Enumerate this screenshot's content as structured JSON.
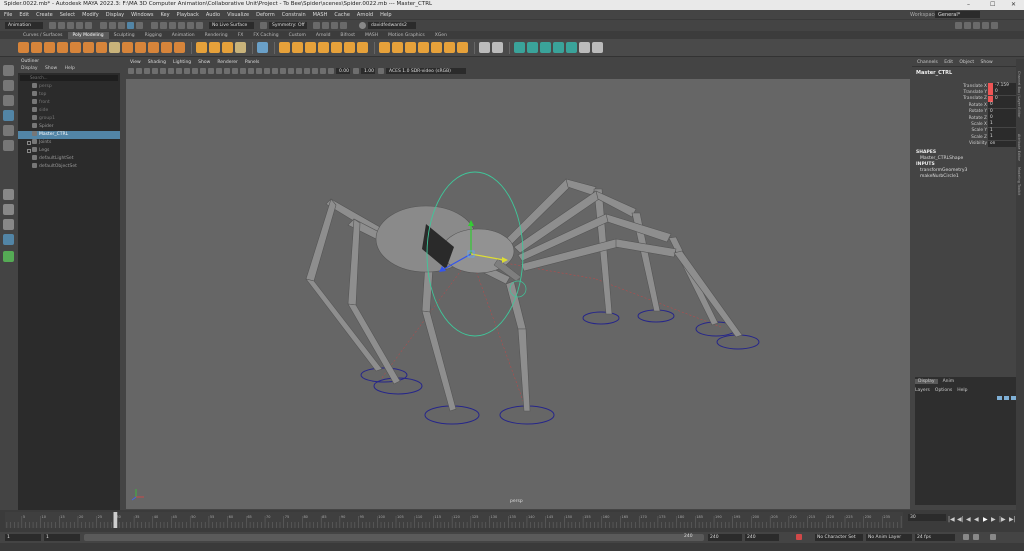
{
  "window": {
    "title": "Spider.0022.mb* - Autodesk MAYA 2022.3: F:\\MA 3D Computer Animation\\Collaborative Unit\\Project - To Bee\\Spider\\scenes\\Spider.0022.mb --- Master_CTRL",
    "controls": [
      "–",
      "☐",
      "✕"
    ]
  },
  "menubar": [
    "File",
    "Edit",
    "Create",
    "Select",
    "Modify",
    "Display",
    "Windows",
    "Key",
    "Playback",
    "Audio",
    "Visualize",
    "Deform",
    "Constrain",
    "MASH",
    "Cache",
    "Arnold",
    "Help"
  ],
  "workspace": {
    "label": "Workspace:",
    "value": "General*"
  },
  "statusline": {
    "mode": "Animation",
    "live_surface": "No Live Surface",
    "symmetry": "Symmetry: Off",
    "user": "davidfedwards2"
  },
  "shelf_tabs": [
    "Curves / Surfaces",
    "Poly Modeling",
    "Sculpting",
    "Rigging",
    "Animation",
    "Rendering",
    "FX",
    "FX Caching",
    "Custom",
    "Arnold",
    "Bifrost",
    "MASH",
    "Motion Graphics",
    "XGen"
  ],
  "shelf_active": "Poly Modeling",
  "outliner": {
    "title": "Outliner",
    "menu": [
      "Display",
      "Show",
      "Help"
    ],
    "search_placeholder": "Search...",
    "items": [
      {
        "label": "persp",
        "state": "dim"
      },
      {
        "label": "top",
        "state": "dim"
      },
      {
        "label": "front",
        "state": "dim"
      },
      {
        "label": "side",
        "state": "dim"
      },
      {
        "label": "group1",
        "state": "dim"
      },
      {
        "label": "Spider",
        "state": "normal"
      },
      {
        "label": "Master_CTRL",
        "state": "selected"
      },
      {
        "label": "Joints",
        "state": "normal"
      },
      {
        "label": "Legs",
        "state": "normal"
      },
      {
        "label": "defaultLightSet",
        "state": "normal"
      },
      {
        "label": "defaultObjectSet",
        "state": "normal"
      }
    ]
  },
  "viewport": {
    "menu": [
      "View",
      "Shading",
      "Lighting",
      "Show",
      "Renderer",
      "Panels"
    ],
    "exposure": "0.00",
    "gamma": "1.00",
    "color_space": "ACES 1.0 SDR-video (sRGB)",
    "camera_label": "persp"
  },
  "channel_box": {
    "tabs": [
      "Channels",
      "Edit",
      "Object",
      "Show"
    ],
    "object": "Master_CTRL",
    "channels": [
      {
        "name": "Translate X",
        "value": "-7.159"
      },
      {
        "name": "Translate Y",
        "value": "0"
      },
      {
        "name": "Translate Z",
        "value": "0"
      },
      {
        "name": "Rotate X",
        "value": "0"
      },
      {
        "name": "Rotate Y",
        "value": "0"
      },
      {
        "name": "Rotate Z",
        "value": "0"
      },
      {
        "name": "Scale X",
        "value": "1"
      },
      {
        "name": "Scale Y",
        "value": "1"
      },
      {
        "name": "Scale Z",
        "value": "1"
      },
      {
        "name": "Visibility",
        "value": "on"
      }
    ],
    "shapes_header": "SHAPES",
    "shape": "Master_CTRLShape",
    "inputs_header": "INPUTS",
    "inputs": [
      "transformGeometry3",
      "makeNurbCircle1"
    ]
  },
  "layer_editor": {
    "tabs": [
      "Display",
      "Anim"
    ],
    "menu": [
      "Layers",
      "Options",
      "Help"
    ]
  },
  "right_strip": [
    "Channel Box / Layer Editor",
    "Attribute Editor",
    "Modeling Toolkit"
  ],
  "timeline": {
    "ticks": [
      "5",
      "10",
      "15",
      "20",
      "25",
      "30",
      "35",
      "40",
      "45",
      "50",
      "55",
      "60",
      "65",
      "70",
      "75",
      "80",
      "85",
      "90",
      "95",
      "100",
      "105",
      "110",
      "115",
      "120",
      "125",
      "130",
      "135",
      "140",
      "145",
      "150",
      "155",
      "160",
      "165",
      "170",
      "175",
      "180",
      "185",
      "190",
      "195",
      "200",
      "205",
      "210",
      "215",
      "220",
      "225",
      "230",
      "235"
    ],
    "current_frame": "30",
    "start": "1",
    "range_start": "1",
    "range_end": "240",
    "end_a": "240",
    "end_b": "240",
    "character_set": "No Character Set",
    "anim_layer": "No Anim Layer",
    "fps": "24 fps"
  },
  "colors": {
    "ui_bg": "#444444",
    "viewport_bg": "#666666",
    "selection": "#5285a6",
    "keyed_channel": "#ee5555",
    "control_curve": "#3fc79a",
    "leg_circles": "#26268a"
  }
}
